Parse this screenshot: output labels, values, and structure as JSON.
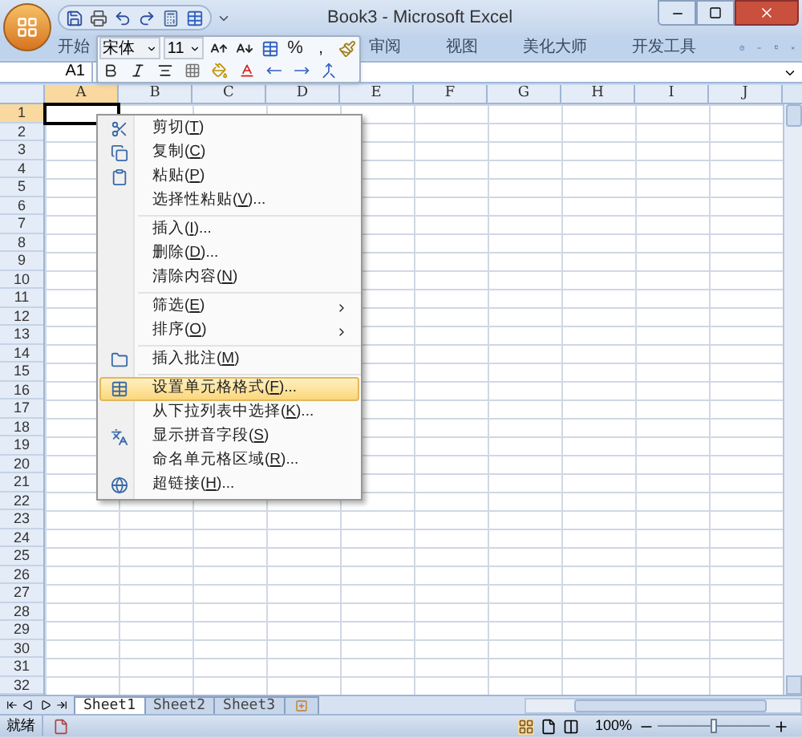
{
  "window": {
    "title": "Book3 - Microsoft Excel"
  },
  "ribbon_tabs": [
    {
      "label": "开始",
      "selected": false
    },
    {
      "label": "审阅",
      "selected": false
    },
    {
      "label": "视图",
      "selected": false
    },
    {
      "label": "美化大师",
      "selected": false
    },
    {
      "label": "开发工具",
      "selected": false
    }
  ],
  "name_box": "A1",
  "mini_toolbar": {
    "font": "宋体",
    "size": "11",
    "percent": "%",
    "comma": ","
  },
  "columns": [
    {
      "label": "A",
      "selected": true
    },
    {
      "label": "B",
      "selected": false
    },
    {
      "label": "C",
      "selected": false
    },
    {
      "label": "D",
      "selected": false
    },
    {
      "label": "E",
      "selected": false
    },
    {
      "label": "F",
      "selected": false
    },
    {
      "label": "G",
      "selected": false
    },
    {
      "label": "H",
      "selected": false
    },
    {
      "label": "I",
      "selected": false
    },
    {
      "label": "J",
      "selected": false
    }
  ],
  "rows": [
    {
      "label": "1",
      "selected": true
    },
    {
      "label": "2",
      "selected": false
    },
    {
      "label": "3",
      "selected": false
    },
    {
      "label": "4",
      "selected": false
    },
    {
      "label": "5",
      "selected": false
    },
    {
      "label": "6",
      "selected": false
    },
    {
      "label": "7",
      "selected": false
    },
    {
      "label": "8",
      "selected": false
    },
    {
      "label": "9",
      "selected": false
    },
    {
      "label": "10",
      "selected": false
    },
    {
      "label": "11",
      "selected": false
    },
    {
      "label": "12",
      "selected": false
    },
    {
      "label": "13",
      "selected": false
    },
    {
      "label": "14",
      "selected": false
    },
    {
      "label": "15",
      "selected": false
    },
    {
      "label": "16",
      "selected": false
    },
    {
      "label": "17",
      "selected": false
    },
    {
      "label": "18",
      "selected": false
    },
    {
      "label": "19",
      "selected": false
    },
    {
      "label": "20",
      "selected": false
    },
    {
      "label": "21",
      "selected": false
    },
    {
      "label": "22",
      "selected": false
    },
    {
      "label": "23",
      "selected": false
    },
    {
      "label": "24",
      "selected": false
    },
    {
      "label": "25",
      "selected": false
    },
    {
      "label": "26",
      "selected": false
    },
    {
      "label": "27",
      "selected": false
    },
    {
      "label": "28",
      "selected": false
    },
    {
      "label": "29",
      "selected": false
    },
    {
      "label": "30",
      "selected": false
    },
    {
      "label": "31",
      "selected": false
    },
    {
      "label": "32",
      "selected": false
    }
  ],
  "context_menu": [
    {
      "kind": "item",
      "before": "剪切(",
      "key": "T",
      "after": ")",
      "selected": false
    },
    {
      "kind": "item",
      "before": "复制(",
      "key": "C",
      "after": ")",
      "selected": false
    },
    {
      "kind": "item",
      "before": "粘贴(",
      "key": "P",
      "after": ")",
      "selected": false
    },
    {
      "kind": "item",
      "before": "选择性粘贴(",
      "key": "V",
      "after": ")...",
      "selected": false
    },
    {
      "kind": "separator"
    },
    {
      "kind": "item",
      "before": "插入(",
      "key": "I",
      "after": ")...",
      "selected": false
    },
    {
      "kind": "item",
      "before": "删除(",
      "key": "D",
      "after": ")...",
      "selected": false
    },
    {
      "kind": "item",
      "before": "清除内容(",
      "key": "N",
      "after": ")",
      "selected": false
    },
    {
      "kind": "separator"
    },
    {
      "kind": "submenu",
      "before": "筛选(",
      "key": "E",
      "after": ")",
      "selected": false
    },
    {
      "kind": "submenu",
      "before": "排序(",
      "key": "O",
      "after": ")",
      "selected": false
    },
    {
      "kind": "separator"
    },
    {
      "kind": "item",
      "before": "插入批注(",
      "key": "M",
      "after": ")",
      "selected": false
    },
    {
      "kind": "separator"
    },
    {
      "kind": "item",
      "before": "设置单元格格式(",
      "key": "F",
      "after": ")...",
      "selected": true
    },
    {
      "kind": "item",
      "before": "从下拉列表中选择(",
      "key": "K",
      "after": ")...",
      "selected": false
    },
    {
      "kind": "item",
      "before": "显示拼音字段(",
      "key": "S",
      "after": ")",
      "selected": false
    },
    {
      "kind": "item",
      "before": "命名单元格区域(",
      "key": "R",
      "after": ")...",
      "selected": false
    },
    {
      "kind": "item",
      "before": "超链接(",
      "key": "H",
      "after": ")...",
      "selected": false
    }
  ],
  "sheet_tabs": [
    {
      "label": "Sheet1",
      "selected": true
    },
    {
      "label": "Sheet2",
      "selected": false
    },
    {
      "label": "Sheet3",
      "selected": false
    }
  ],
  "status_bar": {
    "status": "就绪",
    "zoom": "100%",
    "zoom_slider": {
      "level": 0.5
    }
  }
}
